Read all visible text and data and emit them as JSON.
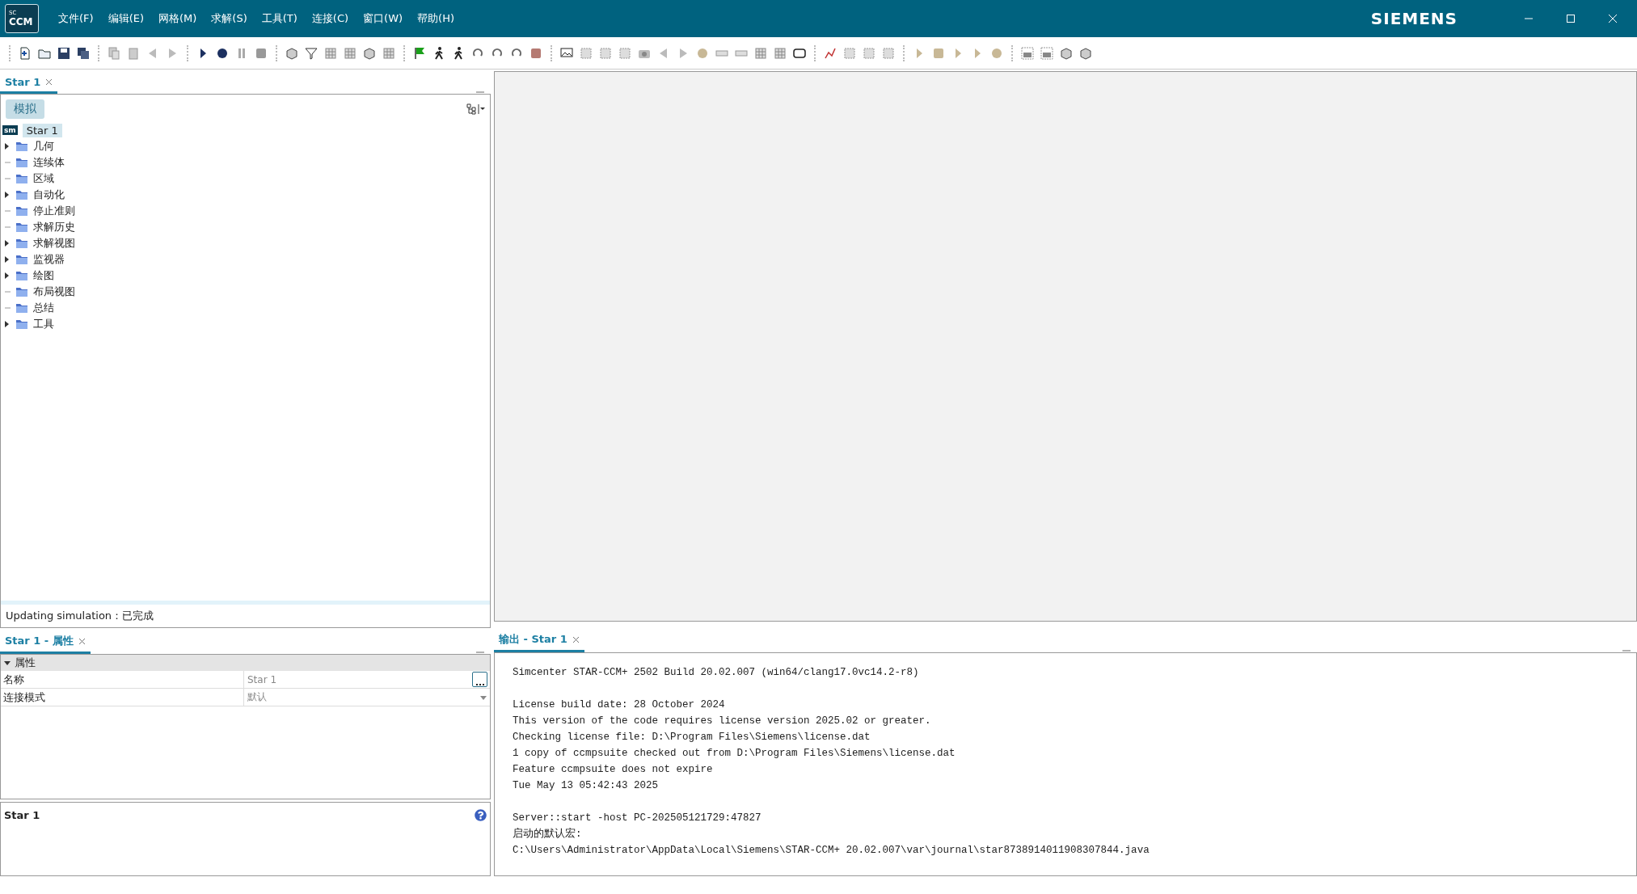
{
  "window": {
    "logo": {
      "small": "SC",
      "main": "CCM"
    },
    "brand": "SIEMENS"
  },
  "menu": [
    {
      "label": "文件(F)"
    },
    {
      "label": "编辑(E)"
    },
    {
      "label": "网格(M)"
    },
    {
      "label": "求解(S)"
    },
    {
      "label": "工具(T)"
    },
    {
      "label": "连接(C)"
    },
    {
      "label": "窗口(W)"
    },
    {
      "label": "帮助(H)"
    }
  ],
  "explorer": {
    "tab": {
      "label": "Star 1",
      "selected": true
    },
    "view_tab": {
      "label": "模拟",
      "selected": true
    },
    "root": {
      "badge": "sm",
      "label": "Star 1",
      "selected": true
    },
    "items": [
      {
        "label": "几何",
        "expandable": true
      },
      {
        "label": "连续体",
        "expandable": false
      },
      {
        "label": "区域",
        "expandable": false
      },
      {
        "label": "自动化",
        "expandable": true
      },
      {
        "label": "停止准则",
        "expandable": false
      },
      {
        "label": "求解历史",
        "expandable": false
      },
      {
        "label": "求解视图",
        "expandable": true
      },
      {
        "label": "监视器",
        "expandable": true
      },
      {
        "label": "绘图",
        "expandable": true
      },
      {
        "label": "布局视图",
        "expandable": false
      },
      {
        "label": "总结",
        "expandable": false
      },
      {
        "label": "工具",
        "expandable": true
      }
    ],
    "status": "Updating simulation：已完成"
  },
  "properties": {
    "tab": {
      "label": "Star 1 - 属性",
      "selected": true
    },
    "section": {
      "label": "属性",
      "expanded": true
    },
    "rows": [
      {
        "label": "名称",
        "value": "Star 1",
        "kind": "ellipsis"
      },
      {
        "label": "连接模式",
        "value": "默认",
        "kind": "dropdown"
      }
    ],
    "description_title": "Star 1"
  },
  "output": {
    "tab": {
      "label": "输出 - Star 1",
      "selected": true
    },
    "blocks": [
      [
        "Simcenter STAR-CCM+ 2502 Build 20.02.007 (win64/clang17.0vc14.2-r8)"
      ],
      [
        "License build date: 28 October 2024",
        "This version of the code requires license version 2025.02 or greater.",
        "Checking license file: D:\\Program Files\\Siemens\\license.dat",
        "1 copy of ccmpsuite checked out from D:\\Program Files\\Siemens\\license.dat",
        "Feature ccmpsuite does not expire",
        "Tue May 13 05:42:43 2025"
      ],
      [
        "Server::start -host PC-202505121729:47827",
        "启动的默认宏:",
        "C:\\Users\\Administrator\\AppData\\Local\\Siemens\\STAR-CCM+ 20.02.007\\var\\journal\\star8738914011908307844.java"
      ]
    ]
  }
}
